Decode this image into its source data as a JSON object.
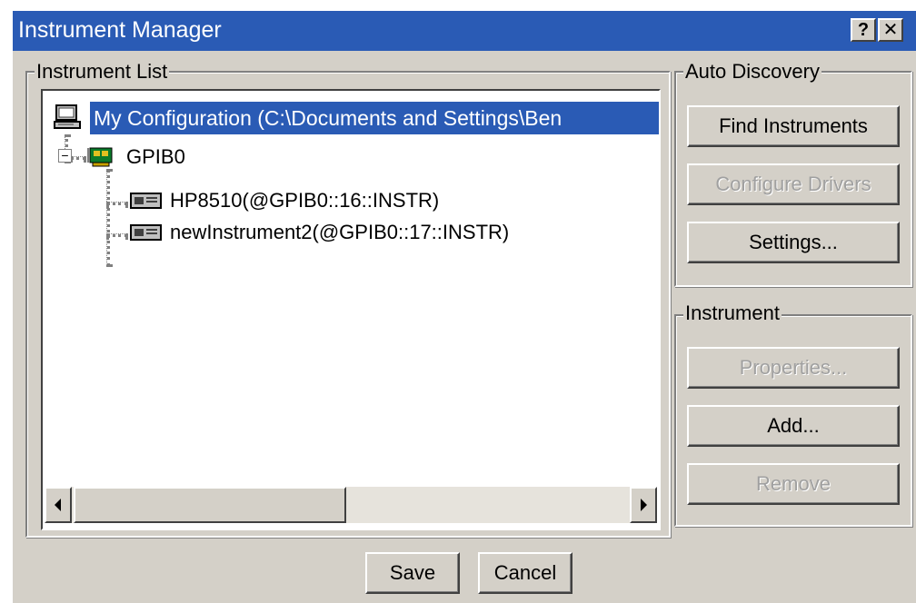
{
  "window": {
    "title": "Instrument Manager",
    "help_label": "?",
    "close_label": "✕"
  },
  "instrument_list": {
    "label": "Instrument List",
    "root": "My Configuration (C:\\Documents and Settings\\Ben",
    "bus": "GPIB0",
    "items": [
      "HP8510(@GPIB0::16::INSTR)",
      "newInstrument2(@GPIB0::17::INSTR)"
    ],
    "expander_symbol": "−"
  },
  "auto_discovery": {
    "label": "Auto Discovery",
    "find_instruments": "Find Instruments",
    "configure_drivers": "Configure Drivers",
    "settings": "Settings..."
  },
  "instrument": {
    "label": "Instrument",
    "properties": "Properties...",
    "add": "Add...",
    "remove": "Remove"
  },
  "footer": {
    "save": "Save",
    "cancel": "Cancel"
  }
}
